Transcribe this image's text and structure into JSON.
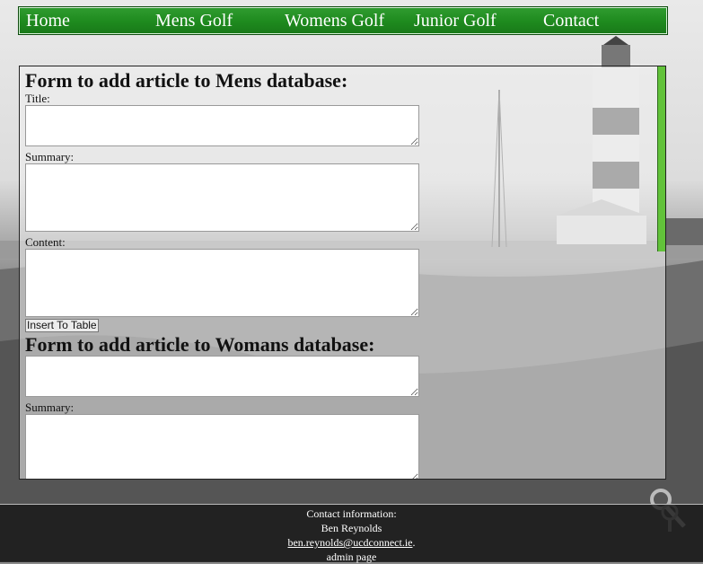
{
  "nav": {
    "items": [
      "Home",
      "Mens Golf",
      "Womens Golf",
      "Junior Golf",
      "Contact"
    ]
  },
  "mens_form": {
    "heading": "Form to add article to Mens database:",
    "title_label": "Title:",
    "summary_label": "Summary:",
    "content_label": "Content:",
    "submit_label": "Insert To Table"
  },
  "womans_form": {
    "heading": "Form to add article to Womans database:",
    "summary_label": "Summary:"
  },
  "footer": {
    "heading": "Contact information:",
    "name": "Ben Reynolds",
    "email": "ben.reynolds@ucdconnect.ie",
    "email_suffix": ".",
    "admin_label": "admin page"
  },
  "colors": {
    "nav_green": "#1e8a1e",
    "scroll_green": "#62c23a"
  }
}
